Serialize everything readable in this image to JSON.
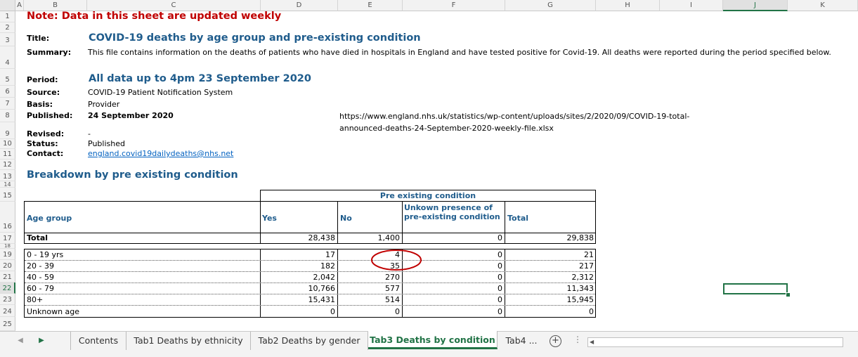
{
  "columns": [
    "A",
    "B",
    "C",
    "D",
    "E",
    "F",
    "G",
    "H",
    "I",
    "J",
    "K"
  ],
  "rows": [
    "1",
    "2",
    "3",
    "4",
    "5",
    "6",
    "7",
    "8",
    "9",
    "10",
    "11",
    "12",
    "13",
    "14",
    "15",
    "16",
    "17",
    "18",
    "19",
    "20",
    "21",
    "22",
    "23",
    "24",
    "25"
  ],
  "note": "Note: Data in this sheet are updated weekly",
  "meta": {
    "title_label": "Title:",
    "title_value": "COVID-19 deaths by age group and pre-existing condition",
    "summary_label": "Summary:",
    "summary_value": "This file contains information on the deaths of patients who have died in hospitals in England and have tested positive for Covid-19. All deaths were reported during the period specified below.",
    "period_label": "Period:",
    "period_value": "All data up to 4pm 23 September 2020",
    "source_label": "Source:",
    "source_value": "COVID-19 Patient Notification System",
    "basis_label": "Basis:",
    "basis_value": "Provider",
    "published_label": "Published:",
    "published_value": "24 September 2020",
    "url_line1": "https://www.england.nhs.uk/statistics/wp-content/uploads/sites/2/2020/09/COVID-19-total-",
    "url_line2": "announced-deaths-24-September-2020-weekly-file.xlsx",
    "revised_label": "Revised:",
    "revised_value": "-",
    "status_label": "Status:",
    "status_value": "Published",
    "contact_label": "Contact:",
    "contact_value": "england.covid19dailydeaths@nhs.net"
  },
  "breakdown_title": "Breakdown by pre existing condition",
  "table": {
    "group_header": "Pre existing condition",
    "col_age": "Age group",
    "col_yes": "Yes",
    "col_no": "No",
    "col_unknown": "Unkown presence of pre-existing condition",
    "col_total": "Total",
    "total_row": {
      "label": "Total",
      "yes": "28,438",
      "no": "1,400",
      "unknown": "0",
      "total": "29,838"
    },
    "rows": [
      {
        "label": "0 - 19 yrs",
        "yes": "17",
        "no": "4",
        "unknown": "0",
        "total": "21"
      },
      {
        "label": "20 - 39",
        "yes": "182",
        "no": "35",
        "unknown": "0",
        "total": "217"
      },
      {
        "label": "40 - 59",
        "yes": "2,042",
        "no": "270",
        "unknown": "0",
        "total": "2,312"
      },
      {
        "label": "60 - 79",
        "yes": "10,766",
        "no": "577",
        "unknown": "0",
        "total": "11,343"
      },
      {
        "label": "80+",
        "yes": "15,431",
        "no": "514",
        "unknown": "0",
        "total": "15,945"
      },
      {
        "label": "Unknown age",
        "yes": "0",
        "no": "0",
        "unknown": "0",
        "total": "0"
      }
    ]
  },
  "tabs": [
    {
      "label": "Contents"
    },
    {
      "label": "Tab1 Deaths by ethnicity"
    },
    {
      "label": "Tab2 Deaths by gender"
    },
    {
      "label": "Tab3 Deaths by condition"
    },
    {
      "label": "Tab4 ..."
    }
  ],
  "active_tab": "Tab3 Deaths by condition",
  "colors": {
    "accent": "#217346",
    "title": "#1f5c8c",
    "note": "#c00000",
    "annotation": "#c00000"
  },
  "icons": {
    "next_sheet": "triangle-right-icon",
    "add_sheet": "plus-circle-icon",
    "more": "ellipsis-icon"
  }
}
